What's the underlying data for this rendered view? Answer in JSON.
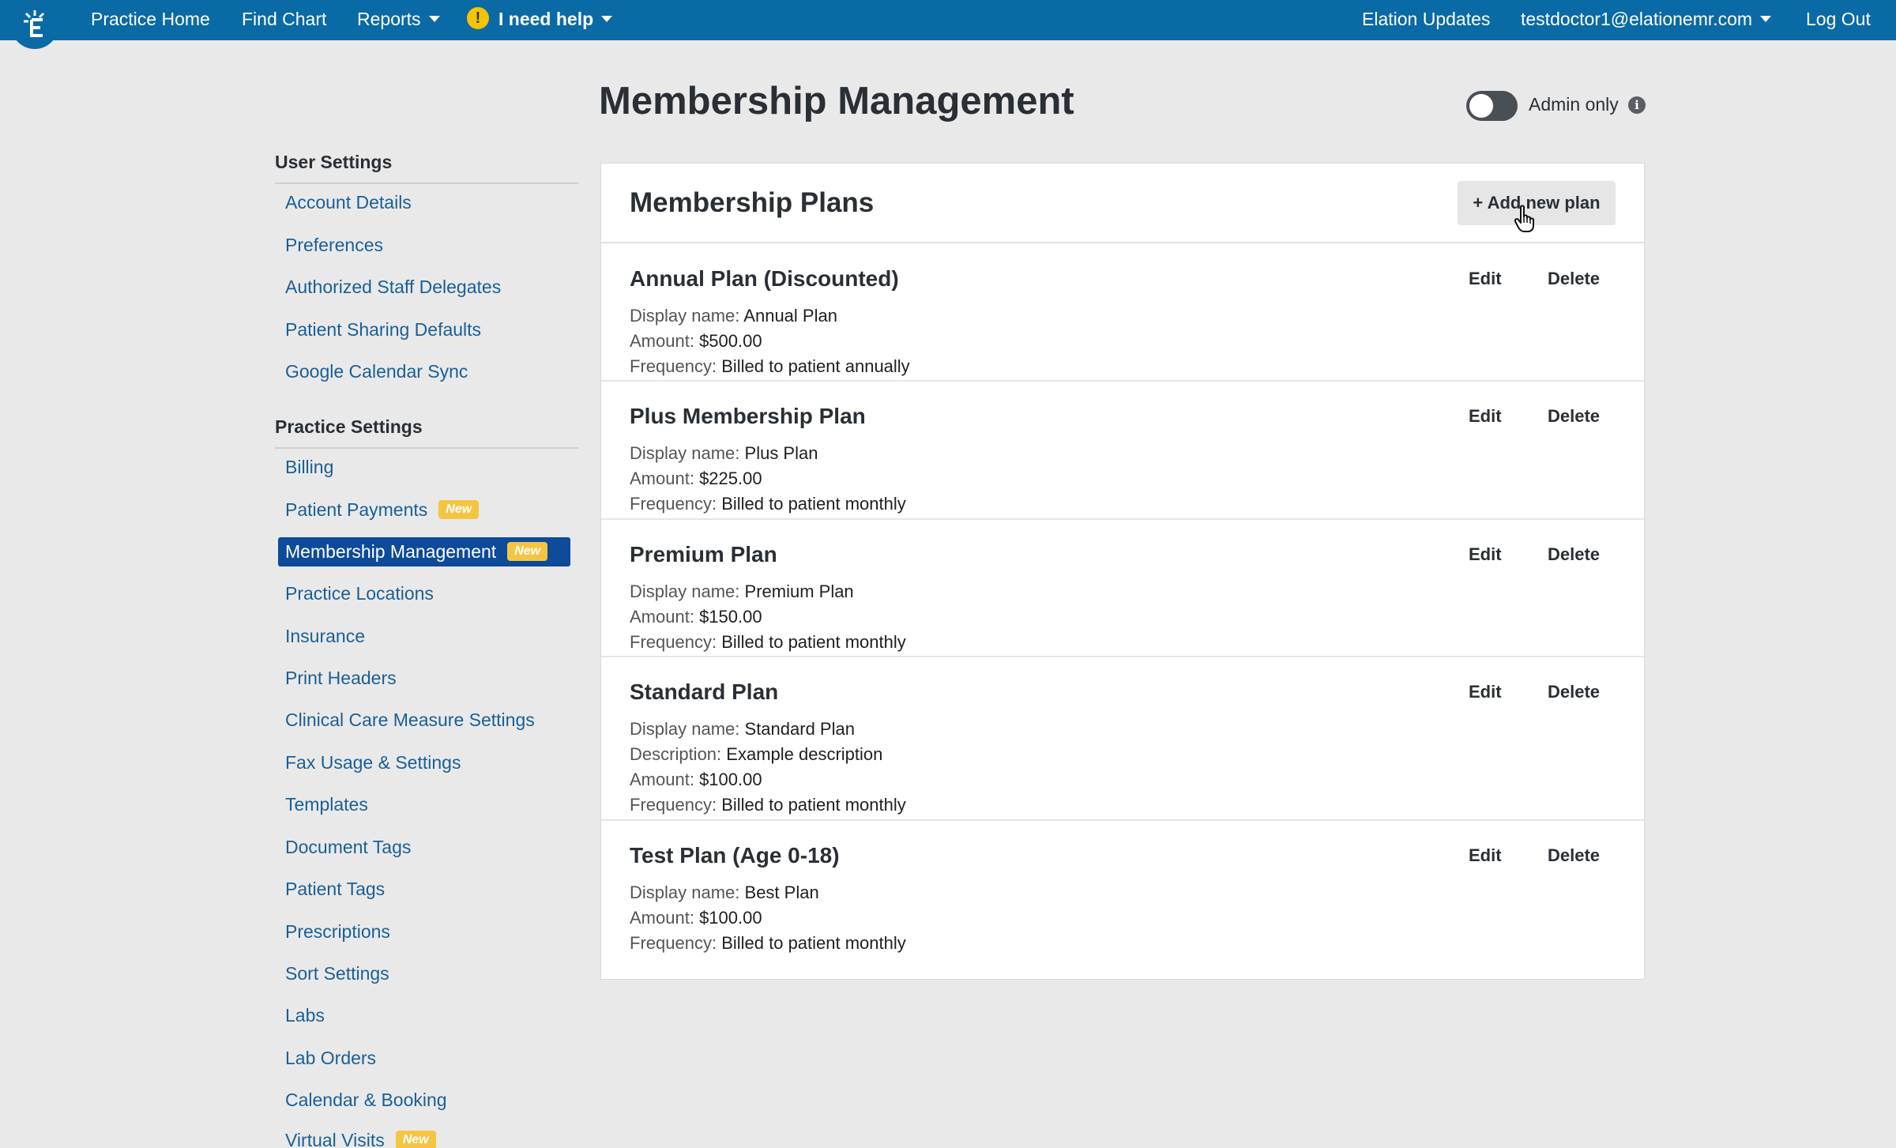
{
  "nav": {
    "items": [
      {
        "label": "Practice Home"
      },
      {
        "label": "Find Chart"
      },
      {
        "label": "Reports"
      },
      {
        "label": "I need help"
      }
    ],
    "right": {
      "updates": "Elation Updates",
      "user_email": "testdoctor1@elationemr.com",
      "logout": "Log Out"
    }
  },
  "page": {
    "title": "Membership Management",
    "admin_only_label": "Admin only",
    "admin_only_enabled": false
  },
  "sidebar": {
    "user_settings": {
      "heading": "User Settings",
      "items": [
        {
          "label": "Account Details"
        },
        {
          "label": "Preferences"
        },
        {
          "label": "Authorized Staff Delegates"
        },
        {
          "label": "Patient Sharing Defaults"
        },
        {
          "label": "Google Calendar Sync"
        }
      ]
    },
    "practice_settings": {
      "heading": "Practice Settings",
      "items": [
        {
          "label": "Billing"
        },
        {
          "label": "Patient Payments",
          "badge": "New"
        },
        {
          "label": "Membership Management",
          "badge": "New",
          "active": true
        },
        {
          "label": "Practice Locations"
        },
        {
          "label": "Insurance"
        },
        {
          "label": "Print Headers"
        },
        {
          "label": "Clinical Care Measure Settings"
        },
        {
          "label": "Fax Usage & Settings"
        },
        {
          "label": "Templates"
        },
        {
          "label": "Document Tags"
        },
        {
          "label": "Patient Tags"
        },
        {
          "label": "Prescriptions"
        },
        {
          "label": "Sort Settings"
        },
        {
          "label": "Labs"
        },
        {
          "label": "Lab Orders"
        },
        {
          "label": "Calendar & Booking"
        },
        {
          "label": "Virtual Visits",
          "badge": "New"
        }
      ]
    }
  },
  "panel": {
    "title": "Membership Plans",
    "add_button": "+ Add new plan",
    "edit_label": "Edit",
    "delete_label": "Delete",
    "labels": {
      "display_name": "Display name:",
      "description": "Description:",
      "amount": "Amount:",
      "frequency": "Frequency:"
    },
    "plans": [
      {
        "name": "Annual Plan (Discounted)",
        "display_name": "Annual Plan",
        "amount": "$500.00",
        "frequency": "Billed to patient annually"
      },
      {
        "name": "Plus Membership Plan",
        "display_name": "Plus Plan",
        "amount": "$225.00",
        "frequency": "Billed to patient monthly"
      },
      {
        "name": "Premium Plan",
        "display_name": "Premium Plan",
        "amount": "$150.00",
        "frequency": "Billed to patient monthly"
      },
      {
        "name": "Standard Plan",
        "display_name": "Standard Plan",
        "description": "Example description",
        "amount": "$100.00",
        "frequency": "Billed to patient monthly"
      },
      {
        "name": "Test Plan (Age 0-18)",
        "display_name": "Best Plan",
        "amount": "$100.00",
        "frequency": "Billed to patient monthly"
      }
    ]
  },
  "colors": {
    "nav_bg": "#0a6aa6",
    "link": "#1a5f96",
    "active_bg": "#0d4a9a",
    "badge": "#f5c542",
    "page_bg": "#e9e9e9"
  }
}
